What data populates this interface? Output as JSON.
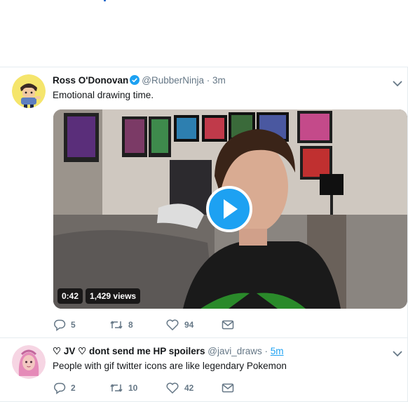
{
  "tweets": [
    {
      "name": "Ross O'Donovan",
      "handle": "@RubberNinja",
      "separator": "·",
      "time": "3m",
      "verified": true,
      "text": "Emotional drawing time.",
      "video": {
        "duration": "0:42",
        "views": "1,429 views"
      },
      "actions": {
        "reply_count": "5",
        "retweet_count": "8",
        "like_count": "94"
      }
    },
    {
      "name": "♡ JV ♡ dont send me HP spoilers",
      "handle": "@javi_draws",
      "separator": "·",
      "time": "5m",
      "verified": false,
      "text": "People with gif twitter icons are like legendary Pokemon",
      "actions": {
        "reply_count": "2",
        "retweet_count": "10",
        "like_count": "42"
      }
    }
  ],
  "icons": {
    "reply": "reply-icon",
    "retweet": "retweet-icon",
    "like": "heart-icon",
    "message": "envelope-icon",
    "caret": "chevron-down-icon",
    "verified": "verified-badge-icon",
    "play": "play-icon"
  },
  "colors": {
    "accent": "#1da1f2",
    "text": "#14171a",
    "muted": "#657786",
    "border": "#e6ecf0"
  }
}
